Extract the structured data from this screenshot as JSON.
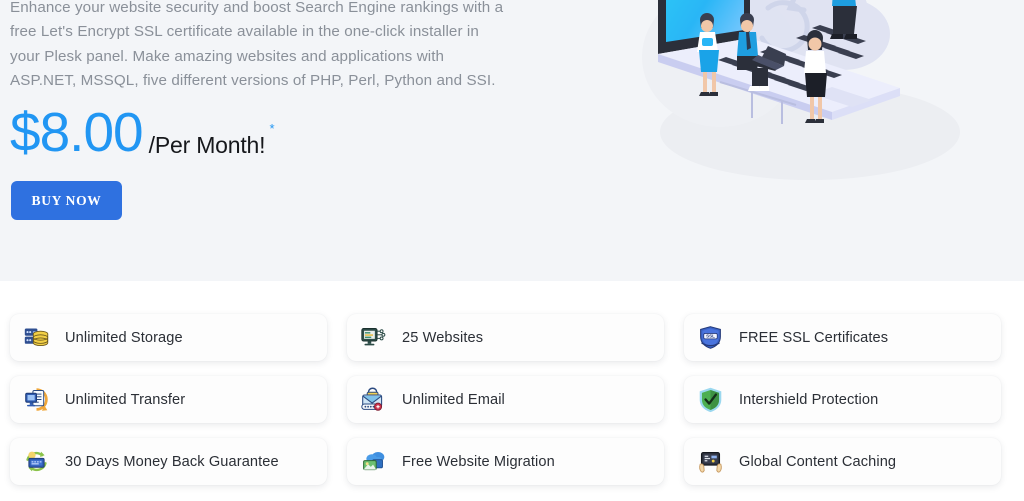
{
  "hero": {
    "description": "Enhance your website security and boost Search Engine rankings with a free Let's Encrypt SSL certificate available in the one-click installer in your Plesk panel. Make amazing websites and applications with ASP.NET, MSSQL, five different versions of PHP, Perl, Python and SSI.",
    "price_amount": "$8.00",
    "price_period": "/Per Month!",
    "price_asterisk": "*",
    "buy_label": "BUY NOW",
    "illustration_name": "isometric-laptop-cloud-team-illustration",
    "accent_color": "#2196f3",
    "button_color": "#2f71e0",
    "background_color": "#f3f5f8"
  },
  "features": {
    "items": [
      {
        "label": "Unlimited Storage",
        "icon": "database-server-icon"
      },
      {
        "label": "25 Websites",
        "icon": "monitor-network-icon"
      },
      {
        "label": "FREE SSL Certificates",
        "icon": "ssl-shield-icon"
      },
      {
        "label": "Unlimited Transfer",
        "icon": "transfer-monitor-icon"
      },
      {
        "label": "Unlimited Email",
        "icon": "email-lock-icon"
      },
      {
        "label": "Intershield Protection",
        "icon": "green-shield-check-icon"
      },
      {
        "label": "30 Days Money Back Guarantee",
        "icon": "money-refund-icon"
      },
      {
        "label": "Free Website Migration",
        "icon": "cloud-migration-icon"
      },
      {
        "label": "Global Content Caching",
        "icon": "hands-screen-icon"
      }
    ]
  }
}
